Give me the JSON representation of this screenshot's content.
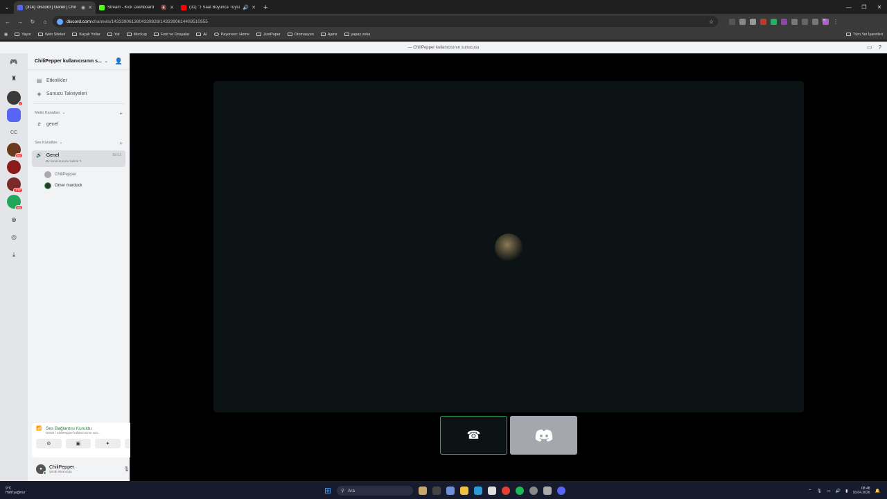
{
  "browser": {
    "tabs": [
      {
        "title": "(314) Discord | Genel | Chil",
        "active": true,
        "favicon_color": "#5865f2",
        "audio": false
      },
      {
        "title": "Stream - Kick Dashboard",
        "active": false,
        "favicon_color": "#53fc18",
        "audio": true
      },
      {
        "title": "(31) \"1 Saat Boyunca Tüylü",
        "active": false,
        "favicon_color": "#ff0000",
        "audio": true
      }
    ],
    "url_host": "discord.com",
    "url_path": "/channels/1433390613604339826/1433390614409510955",
    "bookmarks": [
      "Yayın",
      "Web Siteleri",
      "Kaçak Yollar",
      "Yat",
      "Mockup",
      "Font ve Dosyalar",
      "AI",
      "Payoneer: Home",
      "JustPaper",
      "Otomasyon",
      "Ajans",
      "yapay zeka"
    ],
    "bookmarks_right": "Tüm Yer İşaretleri",
    "profile_initial": "H"
  },
  "discord": {
    "window_title": "— ChiliPepper kullanıcısının sunucusu",
    "server_name": "ChiliPepper kullanıcısının s...",
    "top_items": [
      {
        "label": "Etkinlikler",
        "icon": "calendar-icon"
      },
      {
        "label": "Sunucu Takviyeleri",
        "icon": "boost-icon"
      }
    ],
    "text_category": "Metin Kanalları",
    "text_channels": [
      "genel"
    ],
    "voice_category": "Ses Kanalları",
    "voice_channel": {
      "name": "Genel",
      "timer": "59:12",
      "status": "Bir kanal durumu belirle",
      "members": [
        {
          "name": "ChiliPepper",
          "speaking": false
        },
        {
          "name": "Omer murdock",
          "speaking": true
        }
      ]
    },
    "voice_panel": {
      "title": "Ses Bağlantısı Kuruldu",
      "subtitle": "Genel / ChiliPepper kullanıcısının sun..."
    },
    "user": {
      "name": "ChiliPepper",
      "status": "Şimdi ekranında"
    },
    "server_badges": [
      "50",
      "177",
      "99"
    ],
    "cc_label": "CC"
  },
  "taskbar": {
    "weather_temp": "9°C",
    "weather_desc": "Hafif yağmur",
    "search_placeholder": "Ara",
    "time": "08:48",
    "date": "18.04.2026"
  },
  "colors": {
    "discord_blurple": "#5865f2",
    "voice_green": "#3ba55d",
    "stage_bg": "#000000",
    "tile_bg": "#0b1315"
  }
}
